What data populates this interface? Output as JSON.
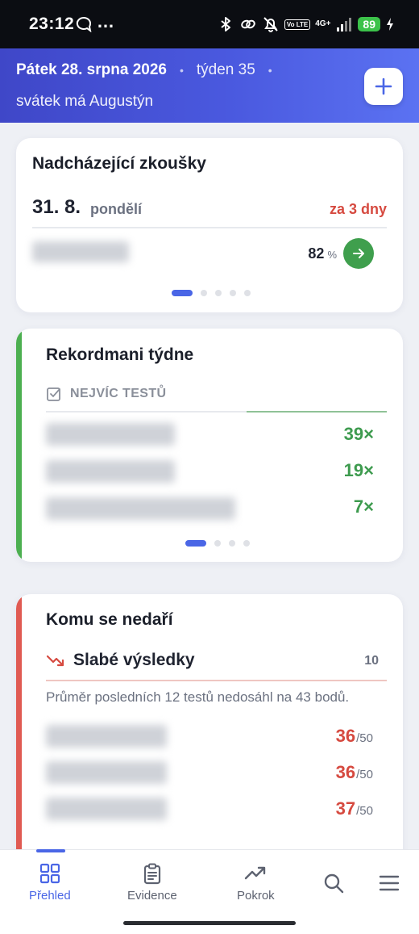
{
  "status_bar": {
    "time": "23:12",
    "dots": "…",
    "volte": "Vo LTE",
    "network": "4G+",
    "battery": "89"
  },
  "header": {
    "date": "Pátek 28. srpna 2026",
    "week": "týden 35",
    "nameday": "svátek má Augustýn",
    "add_icon": "plus-icon"
  },
  "upcoming_exams": {
    "title": "Nadcházející zkoušky",
    "date": "31. 8.",
    "day": "pondělí",
    "relative": "za 3 dny",
    "percent": "82",
    "percent_unit": "%",
    "pages": 5,
    "active_page": 0
  },
  "weekly_records": {
    "title": "Rekordmani týdne",
    "subtitle": "NEJVÍC TESTŮ",
    "counts": [
      "39×",
      "19×",
      "7×"
    ],
    "pages": 4,
    "active_page": 0,
    "accent": "#4caf50"
  },
  "struggling": {
    "title": "Komu se nedaří",
    "subtitle": "Slabé výsledky",
    "count": "10",
    "description": "Průměr posledních 12 testů nedosáhl na 43 bodů.",
    "scores": [
      {
        "value": "36",
        "max": "/50"
      },
      {
        "value": "36",
        "max": "/50"
      },
      {
        "value": "37",
        "max": "/50"
      }
    ],
    "accent": "#e05a52"
  },
  "bottom_nav": {
    "items": [
      {
        "label": "Přehled",
        "icon": "grid-icon"
      },
      {
        "label": "Evidence",
        "icon": "clipboard-icon"
      },
      {
        "label": "Pokrok",
        "icon": "trend-up-icon"
      },
      {
        "label": "",
        "icon": "search-icon"
      },
      {
        "label": "",
        "icon": "menu-icon"
      }
    ],
    "active": 0
  },
  "colors": {
    "primary": "#4a66e6",
    "success": "#3e9b4f",
    "danger": "#d64a40"
  }
}
